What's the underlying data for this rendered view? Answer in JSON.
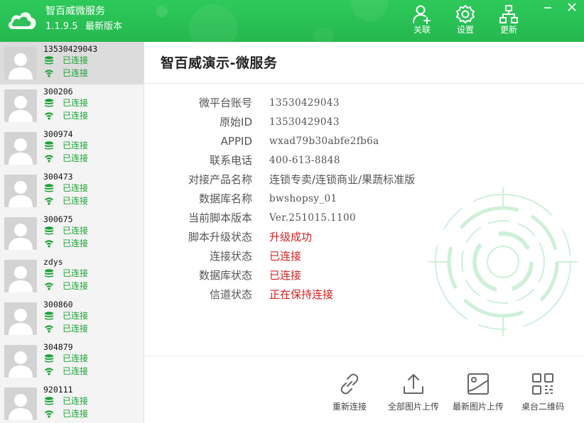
{
  "app": {
    "title": "智百威微服务",
    "version": "1.1.9.5",
    "version_status": "最新版本",
    "accent_color": "#27bd51",
    "status_green": "#1aa335",
    "status_red": "#d42020"
  },
  "header_actions": {
    "follow_label": "关联",
    "settings_label": "设置",
    "update_label": "更新"
  },
  "sidebar": {
    "accounts": [
      {
        "id": "13530429043",
        "db_status": "已连接",
        "net_status": "已连接",
        "selected": true
      },
      {
        "id": "300206",
        "db_status": "已连接",
        "net_status": "已连接"
      },
      {
        "id": "300974",
        "db_status": "已连接",
        "net_status": "已连接"
      },
      {
        "id": "300473",
        "db_status": "已连接",
        "net_status": "已连接"
      },
      {
        "id": "300675",
        "db_status": "已连接",
        "net_status": "已连接"
      },
      {
        "id": "zdys",
        "db_status": "已连接",
        "net_status": "已连接"
      },
      {
        "id": "300860",
        "db_status": "已连接",
        "net_status": "已连接"
      },
      {
        "id": "304879",
        "db_status": "已连接",
        "net_status": "已连接"
      },
      {
        "id": "920111",
        "db_status": "已连接",
        "net_status": "已连接"
      }
    ]
  },
  "main": {
    "title": "智百威演示-微服务",
    "fields": [
      {
        "label": "微平台账号",
        "value": "13530429043",
        "style": "mono"
      },
      {
        "label": "原始ID",
        "value": "13530429043",
        "style": "mono"
      },
      {
        "label": "APPID",
        "value": "wxad79b30abfe2fb6a",
        "style": "mono"
      },
      {
        "label": "联系电话",
        "value": "400-613-8848",
        "style": "mono"
      },
      {
        "label": "对接产品名称",
        "value": "连锁专卖/连锁商业/果蔬标准版",
        "style": "plain"
      },
      {
        "label": "数据库名称",
        "value": "bwshopsy_01",
        "style": "mono"
      },
      {
        "label": "当前脚本版本",
        "value": "Ver.251015.1100",
        "style": "mono"
      },
      {
        "label": "脚本升级状态",
        "value": "升级成功",
        "style": "red"
      },
      {
        "label": "连接状态",
        "value": "已连接",
        "style": "red"
      },
      {
        "label": "数据库状态",
        "value": "已连接",
        "style": "red"
      },
      {
        "label": "信道状态",
        "value": "正在保持连接",
        "style": "red"
      }
    ]
  },
  "toolbar": {
    "reconnect_label": "重新连接",
    "upload_all_label": "全部图片上传",
    "upload_new_label": "最新图片上传",
    "qrcode_label": "桌台二维码"
  },
  "icons": {
    "logo": "cloud-icon",
    "follow": "add-user-icon",
    "settings": "gear-icon",
    "update": "sitemap-icon",
    "db": "database-icon",
    "net": "wifi-icon",
    "reconnect": "link-icon",
    "upload_all": "upload-icon",
    "upload_new": "image-icon",
    "qrcode": "qrcode-icon"
  }
}
